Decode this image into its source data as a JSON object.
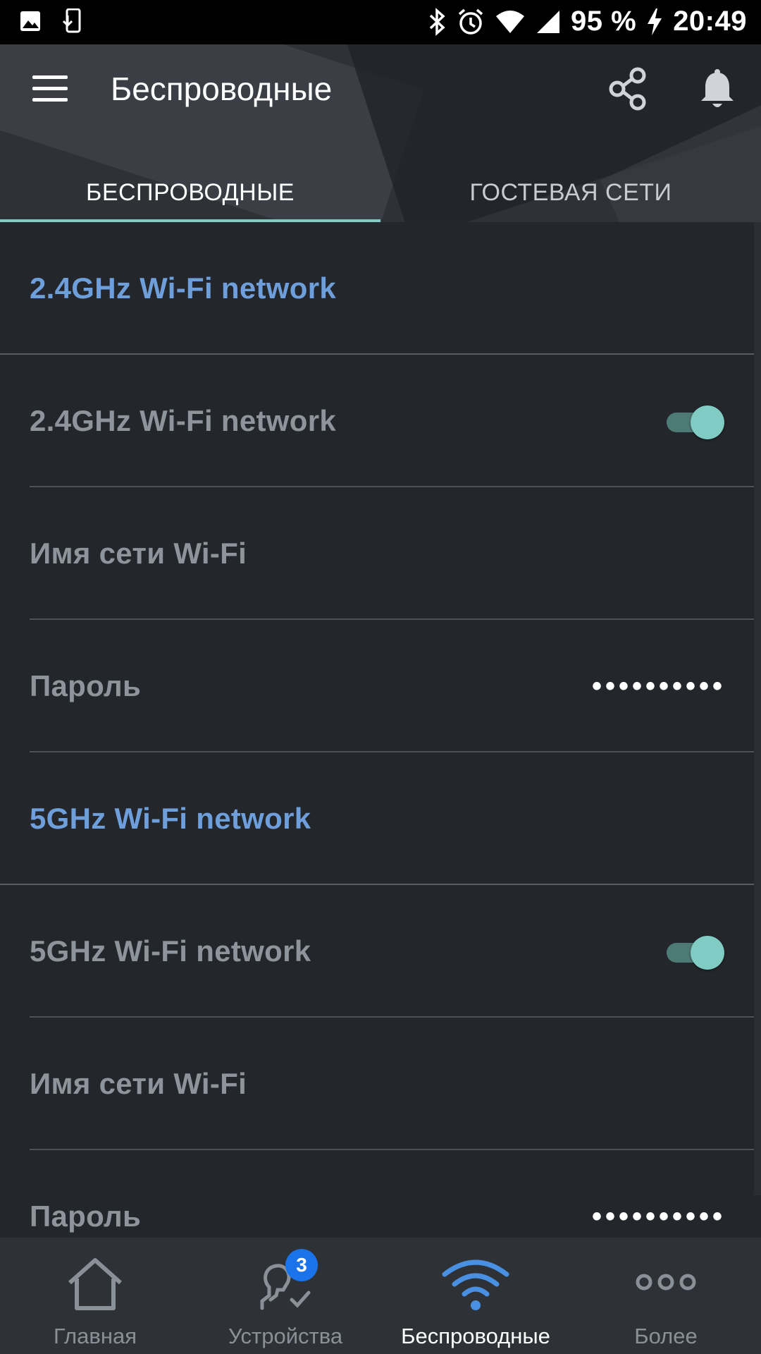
{
  "status_bar": {
    "battery": "95 %",
    "time": "20:49"
  },
  "header": {
    "title": "Беспроводные"
  },
  "tabs": [
    {
      "label": "БЕСПРОВОДНЫЕ",
      "active": true
    },
    {
      "label": "ГОСТЕВАЯ СЕТИ",
      "active": false
    }
  ],
  "sections": [
    {
      "title": "2.4GHz Wi-Fi network",
      "toggle_label": "2.4GHz Wi-Fi network",
      "toggle_on": true,
      "ssid_label": "Имя сети Wi-Fi",
      "password_label": "Пароль",
      "password_value": "••••••••••"
    },
    {
      "title": "5GHz Wi-Fi network",
      "toggle_label": "5GHz Wi-Fi network",
      "toggle_on": true,
      "ssid_label": "Имя сети Wi-Fi",
      "password_label": "Пароль",
      "password_value": "••••••••••"
    }
  ],
  "bottom_nav": {
    "items": [
      {
        "label": "Главная",
        "icon": "home-icon",
        "active": false
      },
      {
        "label": "Устройства",
        "icon": "devices-icon",
        "active": false,
        "badge": "3"
      },
      {
        "label": "Беспроводные",
        "icon": "wifi-icon",
        "active": true
      },
      {
        "label": "Более",
        "icon": "more-icon",
        "active": false
      }
    ]
  },
  "colors": {
    "accent": "#80cbc4",
    "section_title": "#6e9fdb",
    "nav_active": "#4a90e2",
    "badge": "#1a73e8"
  }
}
